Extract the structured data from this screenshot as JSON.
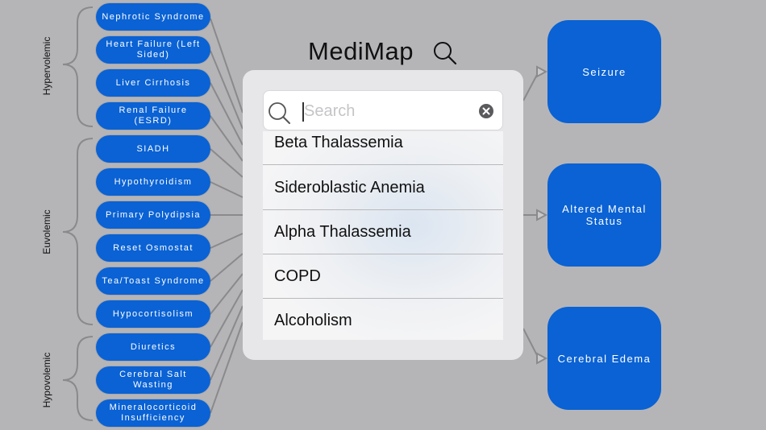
{
  "app": {
    "title": "MediMap"
  },
  "groups": [
    {
      "label": "Hypervolemic"
    },
    {
      "label": "Euvolemic"
    },
    {
      "label": "Hypovolemic"
    }
  ],
  "causes": [
    "Nephrotic Syndrome",
    "Heart Failure (Left Sided)",
    "Liver Cirrhosis",
    "Renal Failure (ESRD)",
    "SIADH",
    "Hypothyroidism",
    "Primary Polydipsia",
    "Reset Osmostat",
    "Tea/Toast Syndrome",
    "Hypocortisolism",
    "Diuretics",
    "Cerebral Salt Wasting",
    "Mineralocorticoid Insufficiency"
  ],
  "outcomes": [
    "Seizure",
    "Altered Mental Status",
    "Cerebral Edema"
  ],
  "search": {
    "placeholder": "Search",
    "value": ""
  },
  "results": [
    "Beta Thalassemia",
    "Sideroblastic Anemia",
    "Alpha Thalassemia",
    "COPD",
    "Alcoholism"
  ],
  "colors": {
    "node": "#0a62d4",
    "background": "#b5b5b8",
    "connector": "#8a8a8d"
  }
}
